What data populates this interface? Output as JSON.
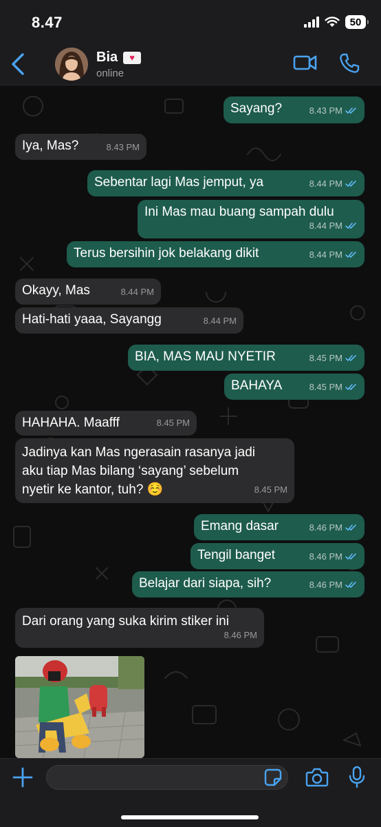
{
  "status_bar": {
    "time": "8.47",
    "battery": "50"
  },
  "contact": {
    "name": "Bia",
    "status": "online",
    "badge_icon": "heart-icon"
  },
  "colors": {
    "accent": "#4aa3f0",
    "outgoing": "#1e5c4d",
    "incoming": "#2c2c2e",
    "read_ticks": "#5fb8f5"
  },
  "messages": [
    {
      "dir": "out",
      "text": "Sayang?",
      "time": "8.43 PM"
    },
    {
      "dir": "in",
      "text": "Iya, Mas?",
      "time": "8.43 PM"
    },
    {
      "dir": "out",
      "text": "Sebentar lagi Mas jemput, ya",
      "time": "8.44 PM"
    },
    {
      "dir": "out",
      "text": "Ini Mas mau buang sampah dulu",
      "time": "8.44 PM"
    },
    {
      "dir": "out",
      "text": "Terus bersihin jok belakang dikit",
      "time": "8.44 PM"
    },
    {
      "dir": "in",
      "text": "Okayy, Mas",
      "time": "8.44 PM"
    },
    {
      "dir": "in",
      "text": "Hati-hati yaaa, Sayangg",
      "time": "8.44 PM"
    },
    {
      "dir": "out",
      "text": "BIA, MAS MAU NYETIR",
      "time": "8.45 PM"
    },
    {
      "dir": "out",
      "text": "BAHAYA",
      "time": "8.45 PM"
    },
    {
      "dir": "in",
      "text": "HAHAHA. Maafff",
      "time": "8.45 PM"
    },
    {
      "dir": "in",
      "line1": "Jadinya kan Mas ngerasain rasanya jadi",
      "line2": "aku tiap Mas bilang ‘sayang’ sebelum",
      "line3": "nyetir ke kantor, tuh? ☺️",
      "time": "8.45 PM"
    },
    {
      "dir": "out",
      "text": "Emang dasar",
      "time": "8.46 PM"
    },
    {
      "dir": "out",
      "text": "Tengil banget",
      "time": "8.46 PM"
    },
    {
      "dir": "out",
      "text": "Belajar dari siapa, sih?",
      "time": "8.46 PM"
    },
    {
      "dir": "in",
      "text": "Dari orang yang suka kirim stiker ini",
      "time": "8.46 PM"
    }
  ],
  "input": {
    "placeholder": ""
  }
}
